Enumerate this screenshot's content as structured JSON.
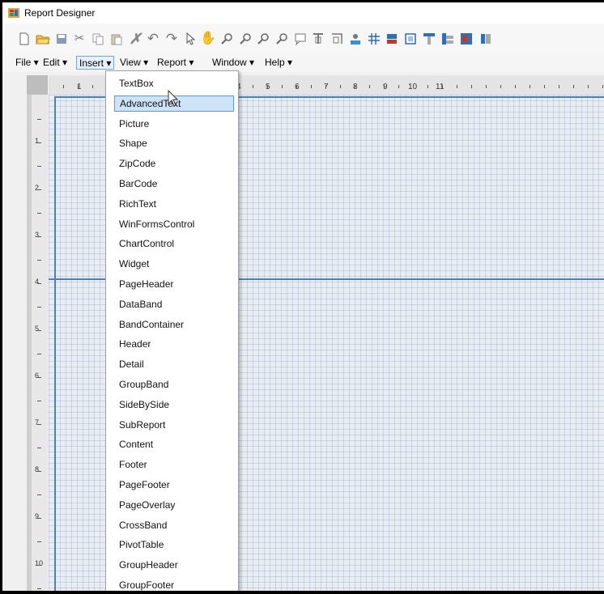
{
  "window": {
    "title": "Report Designer",
    "app_icon": "report-designer-icon"
  },
  "toolbar": {
    "buttons": [
      {
        "name": "new-document-icon"
      },
      {
        "name": "open-folder-icon"
      },
      {
        "name": "save-icon"
      },
      {
        "name": "cut-icon"
      },
      {
        "name": "copy-icon"
      },
      {
        "name": "paste-icon"
      },
      {
        "name": "delete-icon"
      },
      {
        "name": "undo-icon"
      },
      {
        "name": "redo-icon"
      },
      {
        "name": "pointer-icon"
      },
      {
        "name": "hand-pan-icon"
      },
      {
        "name": "zoom-icon"
      },
      {
        "name": "zoom-in-icon"
      },
      {
        "name": "zoom-out-icon"
      },
      {
        "name": "zoom-fit-icon"
      },
      {
        "name": "find-icon"
      },
      {
        "name": "align-left-icon"
      },
      {
        "name": "align-right-icon"
      },
      {
        "name": "group-icon"
      },
      {
        "name": "grid-icon"
      },
      {
        "name": "band-icon"
      },
      {
        "name": "snap-icon"
      },
      {
        "name": "layout-top-icon"
      },
      {
        "name": "layout-left-icon"
      },
      {
        "name": "layout-right-icon"
      },
      {
        "name": "more-icon"
      }
    ]
  },
  "menubar": {
    "items": [
      {
        "label": "File ▾"
      },
      {
        "label": "Edit ▾"
      },
      {
        "label": "Insert ▾"
      },
      {
        "label": "View ▾"
      },
      {
        "label": "Report ▾"
      },
      {
        "label": "Window ▾"
      },
      {
        "label": "Help ▾"
      }
    ],
    "active": "Insert"
  },
  "ruler": {
    "horizontal": [
      "1",
      "4",
      "5",
      "6",
      "7",
      "8",
      "9",
      "10",
      "11"
    ],
    "vertical": [
      "1",
      "2",
      "3",
      "4",
      "5",
      "6",
      "7",
      "8",
      "9",
      "10"
    ]
  },
  "insert_menu": {
    "items": [
      "TextBox",
      "AdvancedText",
      "Picture",
      "Shape",
      "ZipCode",
      "BarCode",
      "RichText",
      "WinFormsControl",
      "ChartControl",
      "Widget",
      "PageHeader",
      "DataBand",
      "BandContainer",
      "Header",
      "Detail",
      "GroupBand",
      "SideBySide",
      "SubReport",
      "Content",
      "Footer",
      "PageFooter",
      "PageOverlay",
      "CrossBand",
      "PivotTable",
      "GroupHeader",
      "GroupFooter"
    ],
    "highlighted": "AdvancedText"
  },
  "colors": {
    "accent": "#4a80c0",
    "canvas": "#e8edf3",
    "highlight": "#cfe3f7"
  }
}
